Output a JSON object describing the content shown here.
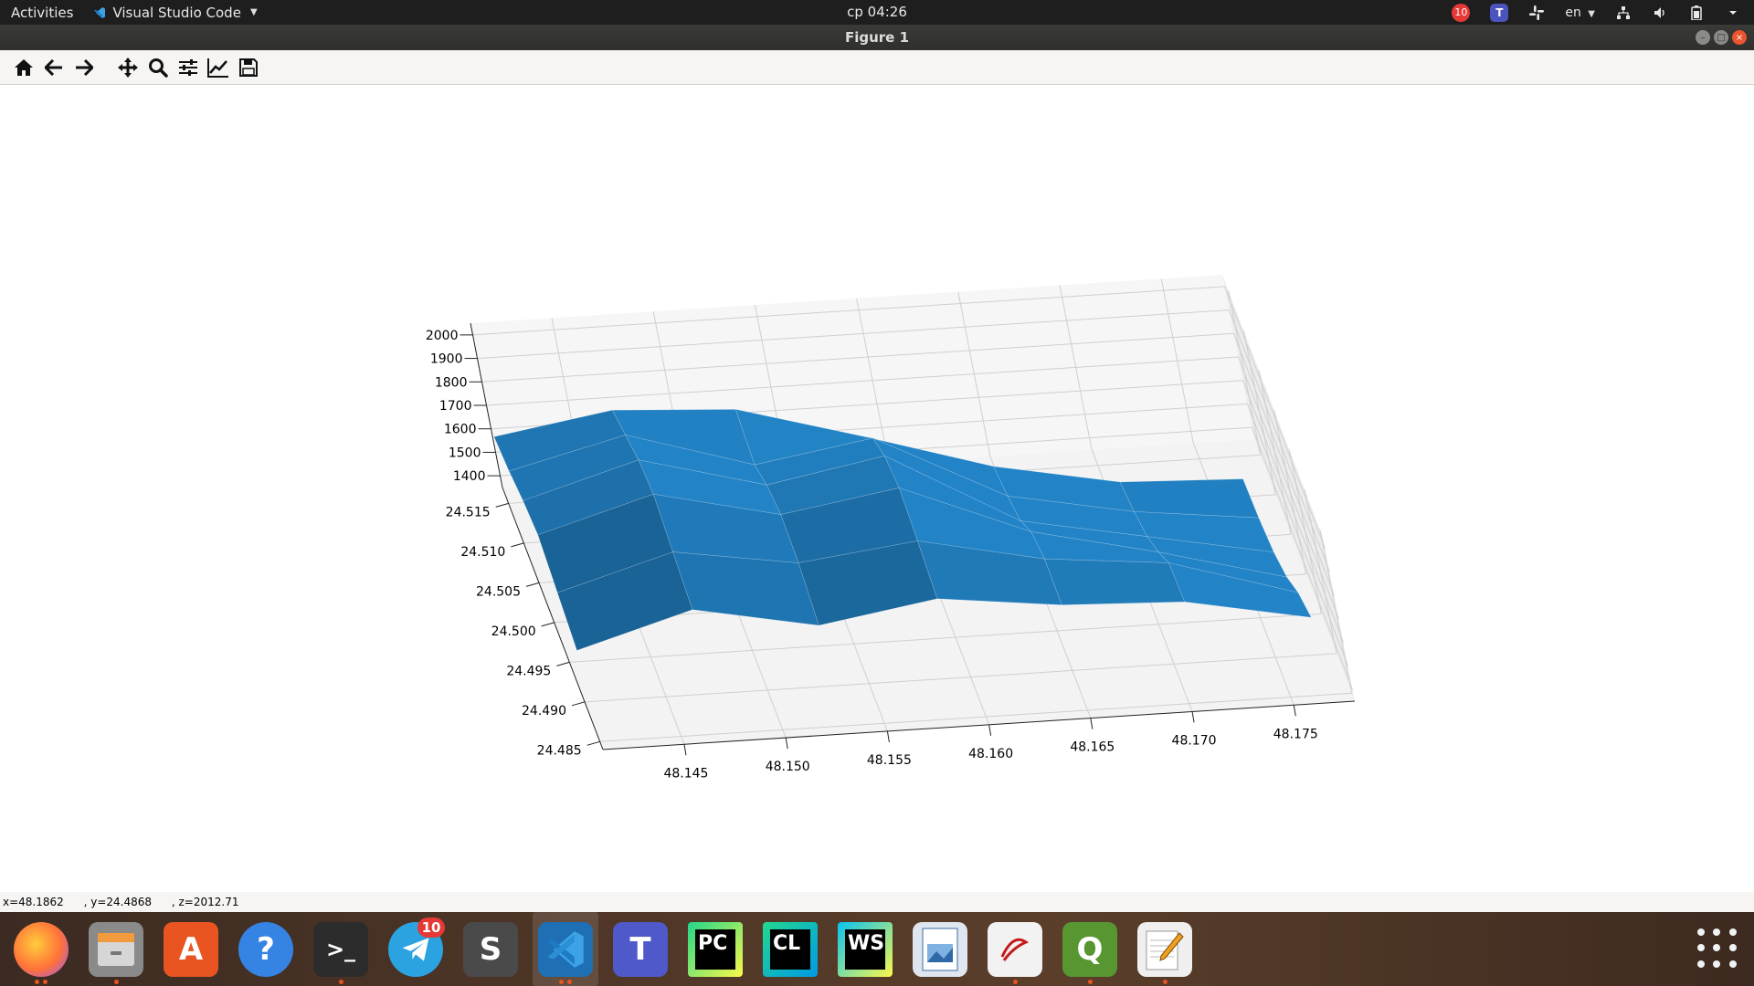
{
  "topbar": {
    "activities_label": "Activities",
    "app_name": "Visual Studio Code",
    "clock": "ср 04:26",
    "notification_count": "10",
    "teams_letter": "T",
    "language": "en"
  },
  "window": {
    "title": "Figure 1"
  },
  "toolbar": {
    "buttons": [
      "home-icon",
      "back-icon",
      "forward-icon",
      "pan-icon",
      "zoom-icon",
      "configure-subplots-icon",
      "edit-axis-icon",
      "save-icon"
    ]
  },
  "statusbar": {
    "x_text": "x=48.1862",
    "y_text": ", y=24.4868",
    "z_text": ", z=2012.71"
  },
  "chart_data": {
    "type": "surface",
    "title": "",
    "xlabel": "",
    "ylabel": "",
    "zlabel": "",
    "color": "#1f77b4",
    "grid": true,
    "x_ticks": [
      "48.145",
      "48.150",
      "48.155",
      "48.160",
      "48.165",
      "48.170",
      "48.175"
    ],
    "y_ticks": [
      "24.485",
      "24.490",
      "24.495",
      "24.500",
      "24.505",
      "24.510",
      "24.515"
    ],
    "z_ticks": [
      "1400",
      "1500",
      "1600",
      "1700",
      "1800",
      "1900",
      "2000"
    ],
    "xlim": [
      48.141,
      48.178
    ],
    "ylim": [
      24.484,
      24.517
    ],
    "zlim": [
      1350,
      2050
    ],
    "x": [
      48.141,
      48.147,
      48.153,
      48.159,
      48.165,
      48.171,
      48.177
    ],
    "y": [
      24.516,
      24.5105,
      24.505,
      24.4995,
      24.494,
      24.4885
    ],
    "z": [
      [
        1600,
        1680,
        1650,
        1500,
        1340,
        1240,
        1220
      ],
      [
        1640,
        1760,
        1600,
        1680,
        1400,
        1300,
        1240
      ],
      [
        1700,
        1840,
        1700,
        1790,
        1480,
        1380,
        1280
      ],
      [
        1740,
        1880,
        1760,
        1840,
        1620,
        1500,
        1360
      ],
      [
        1680,
        1820,
        1740,
        1800,
        1690,
        1640,
        1480
      ],
      [
        1620,
        1760,
        1660,
        1740,
        1680,
        1660,
        1560
      ]
    ]
  },
  "dock": {
    "apps": [
      {
        "name": "firefox",
        "label": "",
        "color": "#e66000",
        "dots": 2
      },
      {
        "name": "files",
        "label": "",
        "color": "#8a8a8a",
        "dots": 1
      },
      {
        "name": "software",
        "label": "A",
        "color": "#e95420",
        "dots": 0
      },
      {
        "name": "help",
        "label": "?",
        "color": "#3584e4",
        "dots": 0
      },
      {
        "name": "terminal",
        "label": ">_",
        "color": "#2c2c2c",
        "dots": 1
      },
      {
        "name": "telegram",
        "label": "",
        "color": "#2aa3e0",
        "dots": 0,
        "badge": "10"
      },
      {
        "name": "sublime",
        "label": "S",
        "color": "#4a4a4a",
        "dots": 0
      },
      {
        "name": "vscode",
        "label": "",
        "color": "#1f6fb5",
        "dots": 2,
        "active": true
      },
      {
        "name": "teams",
        "label": "T",
        "color": "#5059c9",
        "dots": 0
      },
      {
        "name": "pycharm",
        "label": "PC",
        "color": "#111111",
        "dots": 0
      },
      {
        "name": "clion",
        "label": "CL",
        "color": "#111111",
        "dots": 0
      },
      {
        "name": "webstorm",
        "label": "WS",
        "color": "#111111",
        "dots": 0
      },
      {
        "name": "image-viewer",
        "label": "",
        "color": "#dfe6ef",
        "dots": 0
      },
      {
        "name": "evince",
        "label": "",
        "color": "#f2f2f2",
        "dots": 1
      },
      {
        "name": "qgis",
        "label": "Q",
        "color": "#589632",
        "dots": 1
      },
      {
        "name": "text-editor",
        "label": "",
        "color": "#efefef",
        "dots": 1
      }
    ]
  }
}
